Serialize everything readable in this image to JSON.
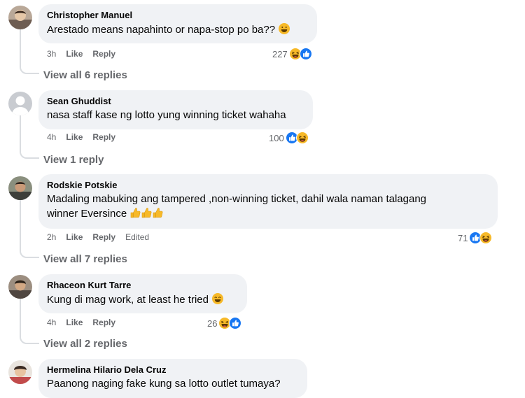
{
  "comments": [
    {
      "author": "Christopher Manuel",
      "text": "Arestado means napahinto or napa-stop po ba??",
      "time": "3h",
      "like": "Like",
      "reply": "Reply",
      "reactions": "227",
      "view_replies": "View all 6 replies"
    },
    {
      "author": "Sean Ghuddist",
      "text": "nasa staff kase ng lotto yung winning ticket wahaha",
      "time": "4h",
      "like": "Like",
      "reply": "Reply",
      "reactions": "100",
      "view_replies": "View 1 reply"
    },
    {
      "author": "Rodskie Potskie",
      "text_line1": "Madaling mabuking ang tampered ,non-winning ticket, dahil wala naman talagang",
      "text_line2": "winner Eversince",
      "time": "2h",
      "like": "Like",
      "reply": "Reply",
      "edited": "Edited",
      "reactions": "71",
      "view_replies": "View all 7 replies"
    },
    {
      "author": "Rhaceon Kurt Tarre",
      "text": "Kung di mag work, at least he tried",
      "time": "4h",
      "like": "Like",
      "reply": "Reply",
      "reactions": "26",
      "view_replies": "View all 2 replies"
    },
    {
      "author": "Hermelina Hilario Dela Cruz",
      "text": "Paanong naging fake kung sa lotto outlet tumaya?"
    }
  ],
  "colors": {
    "bubble": "#f0f2f5",
    "meta": "#65676b",
    "like_blue": "#1877f2",
    "haha_yellow": "#f7b928"
  }
}
